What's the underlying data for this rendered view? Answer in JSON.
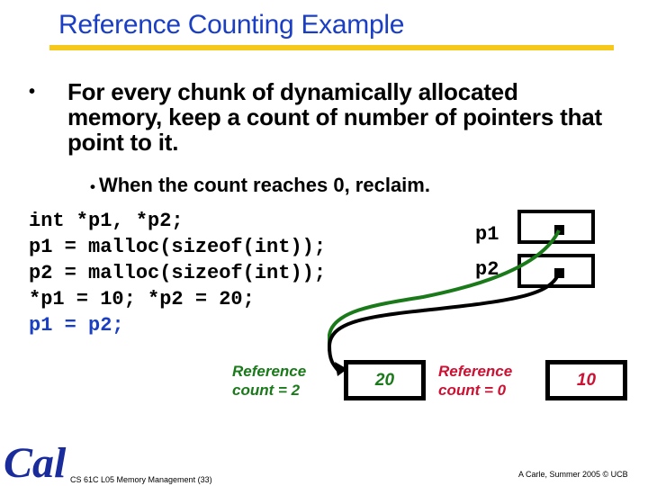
{
  "slide": {
    "title": "Reference Counting Example",
    "bullets": [
      {
        "level": 1,
        "text": "For every chunk of dynamically allocated memory, keep a count of number of pointers that point to it."
      },
      {
        "level": 2,
        "text": "When the count reaches 0, reclaim."
      }
    ],
    "bullet_glyph": "•",
    "code": {
      "lines": [
        "int *p1, *p2;",
        "p1 = malloc(sizeof(int));",
        "p2 = malloc(sizeof(int));",
        "*p1 = 10; *p2 = 20;"
      ],
      "highlighted_line": "p1 = p2;",
      "highlight_color": "#1b3fc4"
    },
    "diagram": {
      "pointers": [
        {
          "label": "p1"
        },
        {
          "label": "p2"
        }
      ],
      "blocks": [
        {
          "value": "20",
          "refcount_line1": "Reference",
          "refcount_line2": "count = 2",
          "color": "#1a7a1a"
        },
        {
          "value": "10",
          "refcount_line1": "Reference",
          "refcount_line2": "count = 0",
          "color": "#cc1133"
        }
      ],
      "arrow_colors": {
        "p1": "#1a7a1a",
        "p2": "#000000"
      }
    },
    "footer": {
      "left": "CS 61C L05 Memory Management (33)",
      "right": "A Carle, Summer 2005 © UCB",
      "logo_text": "Cal"
    },
    "colors": {
      "title": "#1b3fc4",
      "rule": "#f5c81b",
      "logo": "#1a2b9c"
    }
  }
}
